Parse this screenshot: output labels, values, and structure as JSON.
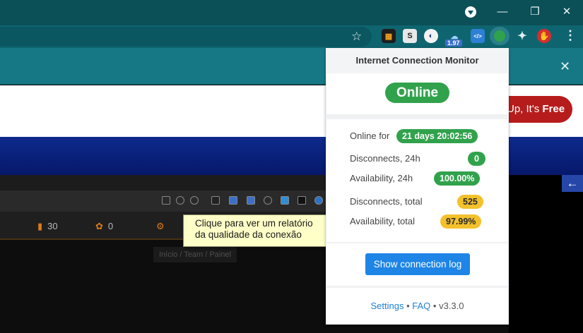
{
  "popup": {
    "title": "Internet Connection Monitor",
    "status": "Online",
    "stats": {
      "online_for_label": "Online for",
      "online_for_value": "21 days 20:02:56",
      "disconnects_24h_label": "Disconnects, 24h",
      "disconnects_24h_value": "0",
      "availability_24h_label": "Availability, 24h",
      "availability_24h_value": "100.00%",
      "disconnects_total_label": "Disconnects, total",
      "disconnects_total_value": "525",
      "availability_total_label": "Availability, total",
      "availability_total_value": "97.99%"
    },
    "log_button": "Show connection log",
    "footer": {
      "settings": "Settings",
      "sep1": "•",
      "faq": "FAQ",
      "sep2": "•",
      "version": "v3.3.0"
    }
  },
  "tooltip": {
    "line1": "Clique para ver um relatório",
    "line2": "da qualidade da conexão"
  },
  "toolbar": {
    "extension_badge": "1.97",
    "s_extension": "S"
  },
  "page": {
    "signup_prefix": "Up, It's ",
    "signup_bold": "Free",
    "stat_files": "30",
    "stat_paws": "0",
    "breadcrumb": "Início  /  Team  /  Painel"
  },
  "colors": {
    "online_green": "#31a24c",
    "warning_yellow": "#f3c12c",
    "button_blue": "#1e85e6",
    "chrome_teal": "#0b4f57"
  }
}
